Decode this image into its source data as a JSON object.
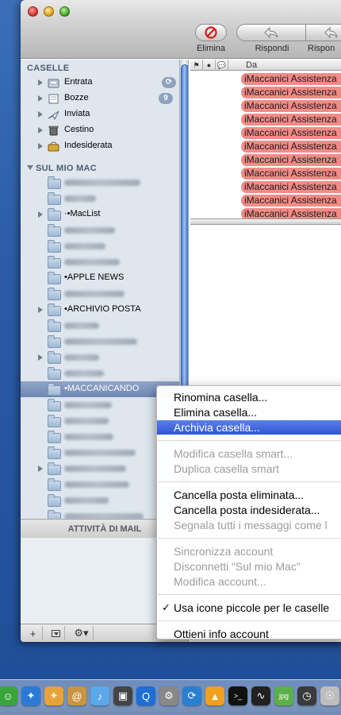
{
  "toolbar": {
    "delete_label": "Elimina",
    "reply_label": "Rispondi",
    "reply_all_label": "Rispon"
  },
  "sidebar": {
    "mailboxes_header": "CASELLE",
    "mailboxes": [
      {
        "label": "Entrata",
        "icon": "inbox-icon",
        "badge": "",
        "activity": true
      },
      {
        "label": "Bozze",
        "icon": "drafts-icon",
        "badge": "9"
      },
      {
        "label": "Inviata",
        "icon": "sent-icon"
      },
      {
        "label": "Cestino",
        "icon": "trash-icon"
      },
      {
        "label": "Indesiderata",
        "icon": "junk-icon"
      }
    ],
    "on_my_mac_header": "SUL MIO MAC",
    "folders": [
      {
        "label": "",
        "blurred": true,
        "disclosure": false,
        "blur_width": 96
      },
      {
        "label": "",
        "blurred": true,
        "disclosure": false,
        "blur_width": 40
      },
      {
        "label": "·•MacList",
        "blurred": false,
        "disclosure": true
      },
      {
        "label": "",
        "blurred": true,
        "disclosure": false,
        "blur_width": 64
      },
      {
        "label": "",
        "blurred": true,
        "disclosure": false,
        "blur_width": 52
      },
      {
        "label": "",
        "blurred": true,
        "disclosure": false,
        "blur_width": 70
      },
      {
        "label": "•APPLE NEWS",
        "blurred": false,
        "disclosure": false
      },
      {
        "label": "",
        "blurred": true,
        "disclosure": false,
        "blur_width": 76
      },
      {
        "label": "•ARCHIVIO POSTA",
        "blurred": false,
        "disclosure": true
      },
      {
        "label": "",
        "blurred": true,
        "disclosure": false,
        "blur_width": 44
      },
      {
        "label": "",
        "blurred": true,
        "disclosure": false,
        "blur_width": 92
      },
      {
        "label": "",
        "blurred": true,
        "disclosure": true,
        "blur_width": 44
      },
      {
        "label": "",
        "blurred": true,
        "disclosure": false,
        "blur_width": 50
      },
      {
        "label": "•MACCANICANDO",
        "blurred": false,
        "disclosure": false,
        "selected": true
      },
      {
        "label": "",
        "blurred": true,
        "disclosure": false,
        "blur_width": 60
      },
      {
        "label": "",
        "blurred": true,
        "disclosure": false,
        "blur_width": 56
      },
      {
        "label": "",
        "blurred": true,
        "disclosure": false,
        "blur_width": 62
      },
      {
        "label": "",
        "blurred": true,
        "disclosure": false,
        "blur_width": 90
      },
      {
        "label": "",
        "blurred": true,
        "disclosure": true,
        "blur_width": 78
      },
      {
        "label": "",
        "blurred": true,
        "disclosure": false,
        "blur_width": 82
      },
      {
        "label": "",
        "blurred": true,
        "disclosure": false,
        "blur_width": 56
      },
      {
        "label": "",
        "blurred": true,
        "disclosure": false,
        "blur_width": 100
      }
    ],
    "activity_label": "ATTIVITÀ DI MAIL"
  },
  "message_list": {
    "from_header": "Da",
    "rows": [
      "iMaccanici Assistenza",
      "iMaccanici Assistenza",
      "iMaccanici Assistenza",
      "iMaccanici Assistenza",
      "iMaccanici Assistenza",
      "iMaccanici Assistenza",
      "iMaccanici Assistenza",
      "iMaccanici Assistenza",
      "iMaccanici Assistenza",
      "iMaccanici Assistenza",
      "iMaccanici Assistenza"
    ],
    "row_color": "#f28b87"
  },
  "context_menu": {
    "groups": [
      [
        {
          "label": "Rinomina casella...",
          "enabled": true
        },
        {
          "label": "Elimina casella...",
          "enabled": true
        },
        {
          "label": "Archivia casella...",
          "enabled": true,
          "highlighted": true
        }
      ],
      [
        {
          "label": "Modifica casella smart...",
          "enabled": false
        },
        {
          "label": "Duplica casella smart",
          "enabled": false
        }
      ],
      [
        {
          "label": "Cancella posta eliminata...",
          "enabled": true
        },
        {
          "label": "Cancella posta indesiderata...",
          "enabled": true
        },
        {
          "label": "Segnala tutti i messaggi come l",
          "enabled": false
        }
      ],
      [
        {
          "label": "Sincronizza account",
          "enabled": false
        },
        {
          "label": "Disconnetti “Sul mio Mac”",
          "enabled": false
        },
        {
          "label": "Modifica account...",
          "enabled": false
        }
      ],
      [
        {
          "label": "Usa icone piccole per le caselle",
          "enabled": true,
          "checked": true
        }
      ],
      [
        {
          "label": "Ottieni info account",
          "enabled": true
        }
      ]
    ]
  },
  "dock": {
    "icons": [
      "finder-icon",
      "safari-icon",
      "safari-icon",
      "address-book-icon",
      "itunes-icon",
      "screen-icon",
      "quicktime-icon",
      "system-preferences-icon",
      "sync-icon",
      "vlc-icon",
      "terminal-icon",
      "activity-monitor-icon",
      "preview-jpg-icon",
      "time-machine-icon",
      "accessibility-icon"
    ]
  },
  "colors": {
    "selection": "#6f88b3",
    "menu_highlight": "#2e56d6",
    "badge": "#8fa1bd"
  }
}
